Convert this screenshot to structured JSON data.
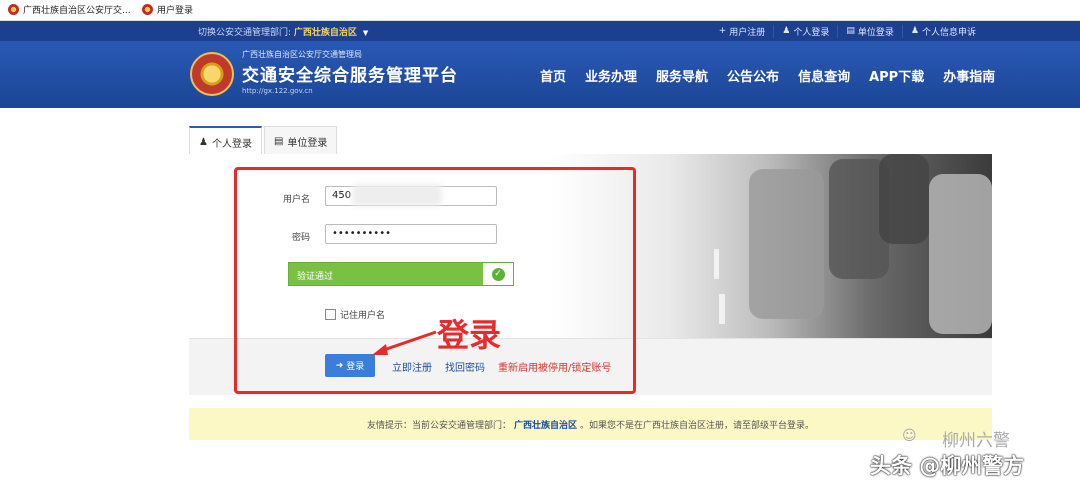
{
  "bookmarks": [
    "广西壮族自治区公安厅交...",
    "用户登录"
  ],
  "topbar": {
    "dept_label": "切换公安交通管理部门:",
    "dept_value": "广西壮族自治区",
    "links": [
      "用户注册",
      "个人登录",
      "单位登录",
      "个人信息申诉"
    ]
  },
  "header": {
    "subtitle": "广西壮族自治区公安厅交通管理局",
    "title": "交通安全综合服务管理平台",
    "url": "http://gx.122.gov.cn",
    "nav": [
      "首页",
      "业务办理",
      "服务导航",
      "公告公布",
      "信息查询",
      "APP下载",
      "办事指南"
    ]
  },
  "tabs": [
    "个人登录",
    "单位登录"
  ],
  "form": {
    "username_label": "用户名",
    "username_value": "450",
    "password_label": "密码",
    "password_value": "••••••••••",
    "verify_text": "验证通过",
    "remember_label": "记住用户名",
    "login_button": "登录",
    "register_link": "立即注册",
    "recover_link": "找回密码",
    "reactivate_link": "重新启用被停用/锁定账号"
  },
  "annotation": "登录",
  "notice": {
    "prefix": "友情提示：当前公安交通管理部门：",
    "dept": "广西壮族自治区",
    "suffix": "。如果您不是在广西壮族自治区注册，请至部级平台登录。"
  },
  "watermarks": {
    "account": "柳州六警",
    "source": "头条 @柳州警方"
  },
  "colors": {
    "header_blue": "#2a59b4",
    "verify_green": "#7ac143",
    "annotation_red": "#e52b2b",
    "login_button": "#3a7ddb"
  }
}
